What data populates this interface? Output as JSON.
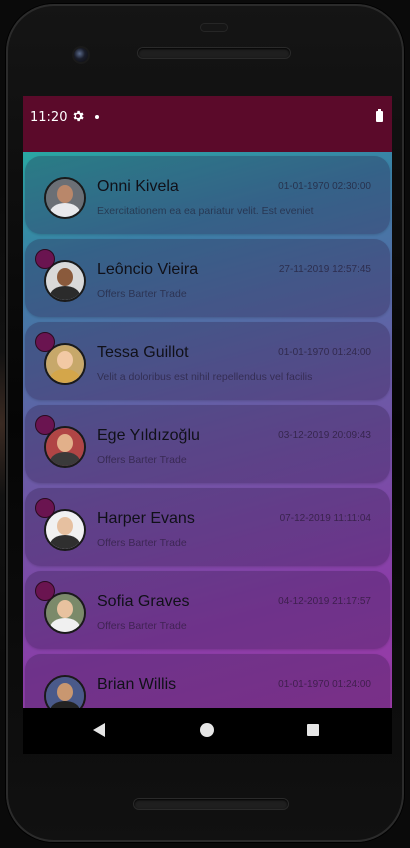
{
  "status_bar": {
    "time": "11:20",
    "icons": [
      "settings-gear-icon",
      "notification-dot-icon",
      "battery-icon"
    ],
    "color": "#5b0a2a"
  },
  "conversations": [
    {
      "name": "Onni Kivela",
      "timestamp": "01-01-1970 02:30:00",
      "preview": "Exercitationem ea ea pariatur velit. Est eveniet",
      "unread_badge": false
    },
    {
      "name": "Leôncio Vieira",
      "timestamp": "27-11-2019 12:57:45",
      "preview": "Offers Barter Trade",
      "unread_badge": true
    },
    {
      "name": "Tessa Guillot",
      "timestamp": "01-01-1970 01:24:00",
      "preview": "Velit a doloribus est nihil repellendus vel facilis",
      "unread_badge": true
    },
    {
      "name": "Ege Yıldızoğlu",
      "timestamp": "03-12-2019 20:09:43",
      "preview": "Offers Barter Trade",
      "unread_badge": true
    },
    {
      "name": "Harper Evans",
      "timestamp": "07-12-2019 11:11:04",
      "preview": "Offers Barter Trade",
      "unread_badge": true
    },
    {
      "name": "Sofia Graves",
      "timestamp": "04-12-2019 21:17:57",
      "preview": "Offers Barter Trade",
      "unread_badge": true
    },
    {
      "name": "Brian Willis",
      "timestamp": "01-01-1970 01:24:00",
      "preview": "",
      "unread_badge": false
    }
  ],
  "nav_bar": {
    "icons": [
      "back-icon",
      "home-icon",
      "recent-apps-icon"
    ]
  },
  "colors": {
    "gradient_top": "#2aa7a3",
    "gradient_bottom": "#9a3aa6",
    "badge": "#6a1450"
  }
}
